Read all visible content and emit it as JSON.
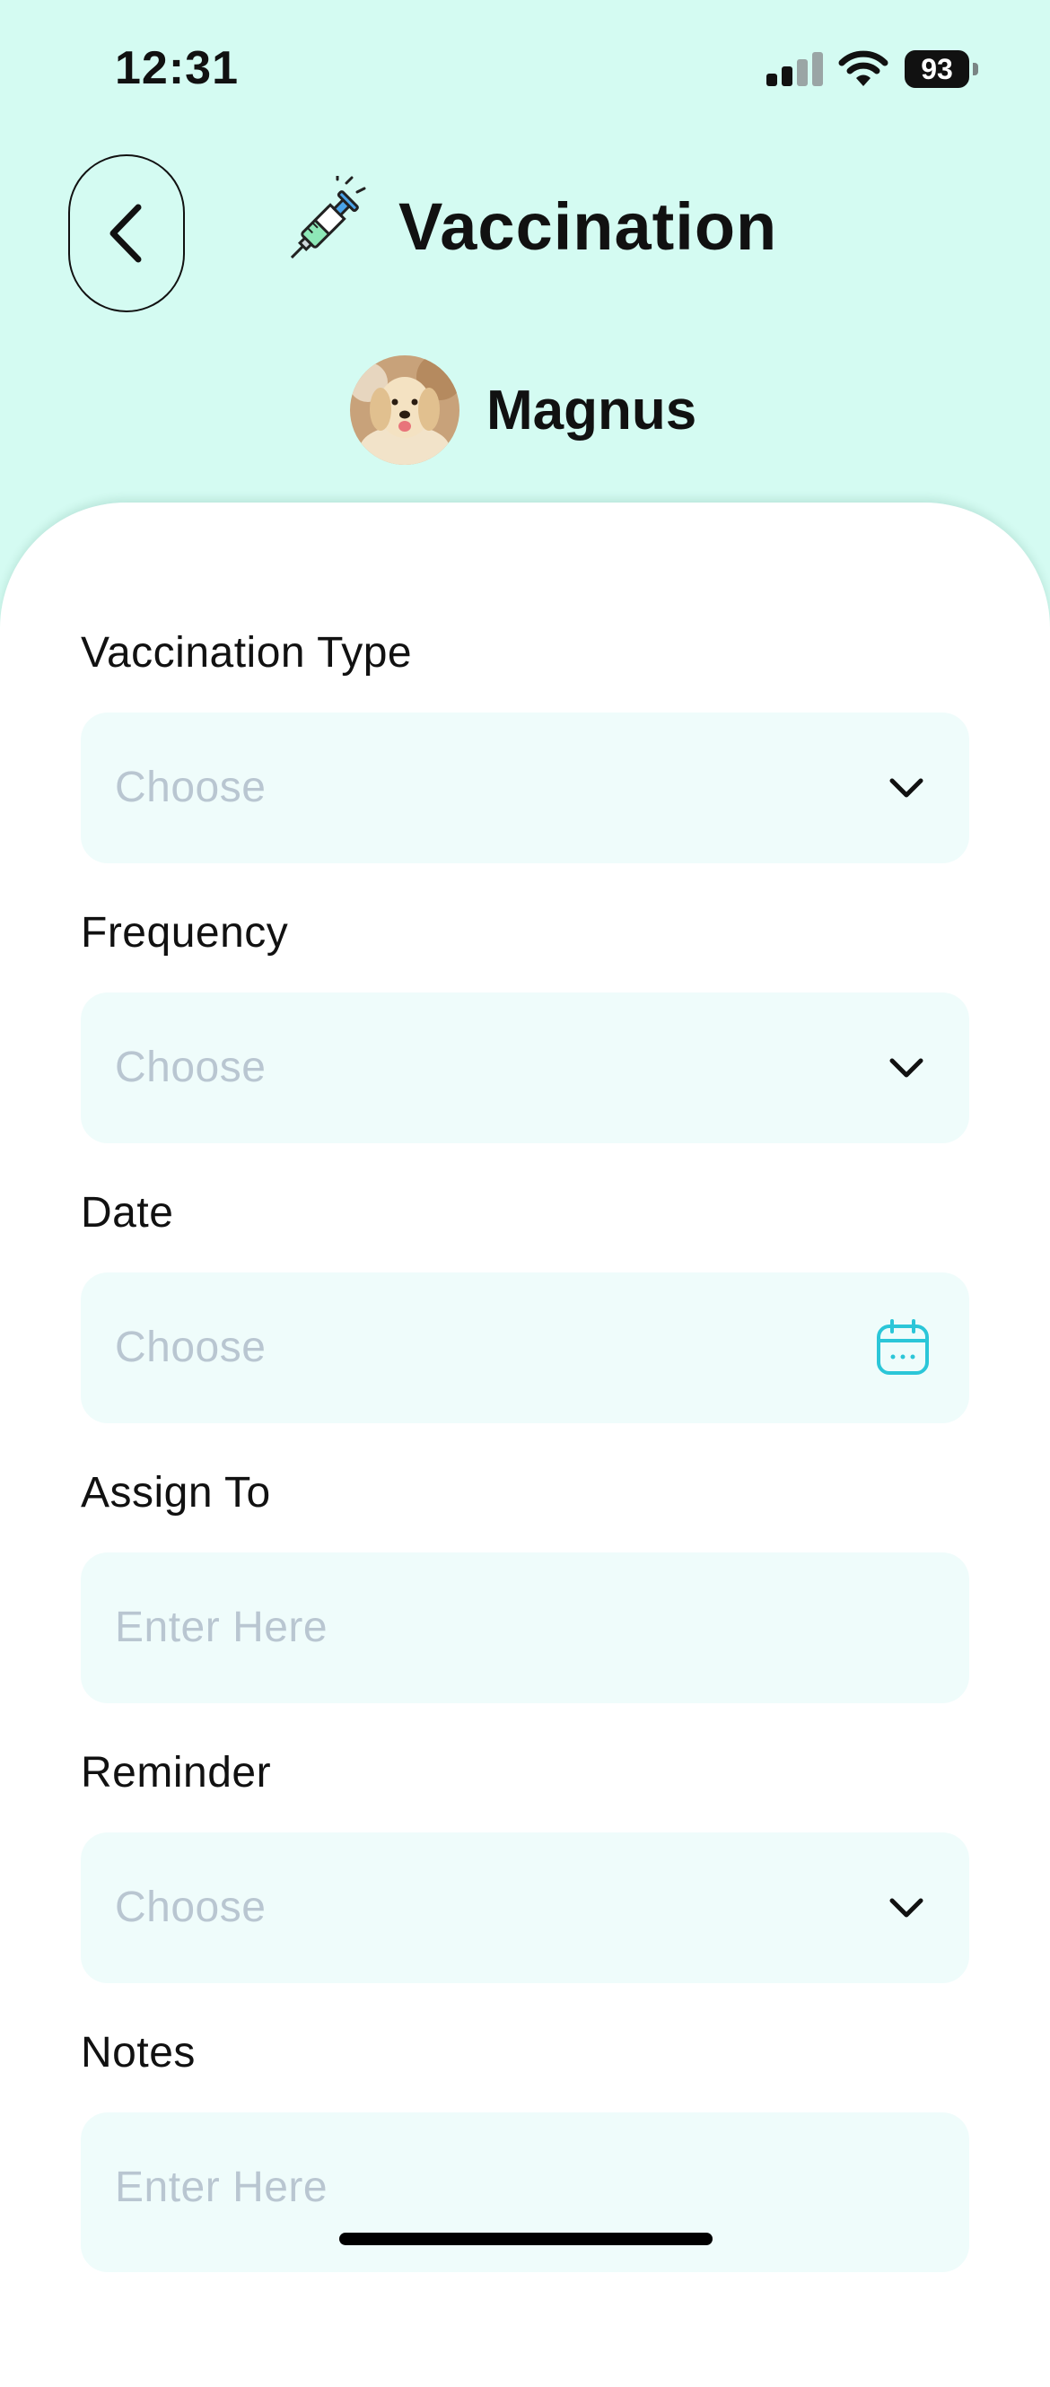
{
  "status_bar": {
    "time": "12:31",
    "battery": "93"
  },
  "header": {
    "title": "Vaccination",
    "pet_name": "Magnus"
  },
  "form": {
    "fields": [
      {
        "label": "Vaccination Type",
        "placeholder": "Choose",
        "icon": "chevron-down-icon"
      },
      {
        "label": "Frequency",
        "placeholder": "Choose",
        "icon": "chevron-down-icon"
      },
      {
        "label": "Date",
        "placeholder": "Choose",
        "icon": "calendar-icon"
      },
      {
        "label": "Assign To",
        "placeholder": "Enter Here",
        "icon": ""
      },
      {
        "label": "Reminder",
        "placeholder": "Choose",
        "icon": "chevron-down-icon"
      },
      {
        "label": "Notes",
        "placeholder": "Enter Here",
        "icon": ""
      }
    ]
  },
  "colors": {
    "background": "#d4fbf2",
    "field_bg": "#effcfb",
    "placeholder": "#b9c6d1",
    "accent": "#2bc6d8"
  }
}
